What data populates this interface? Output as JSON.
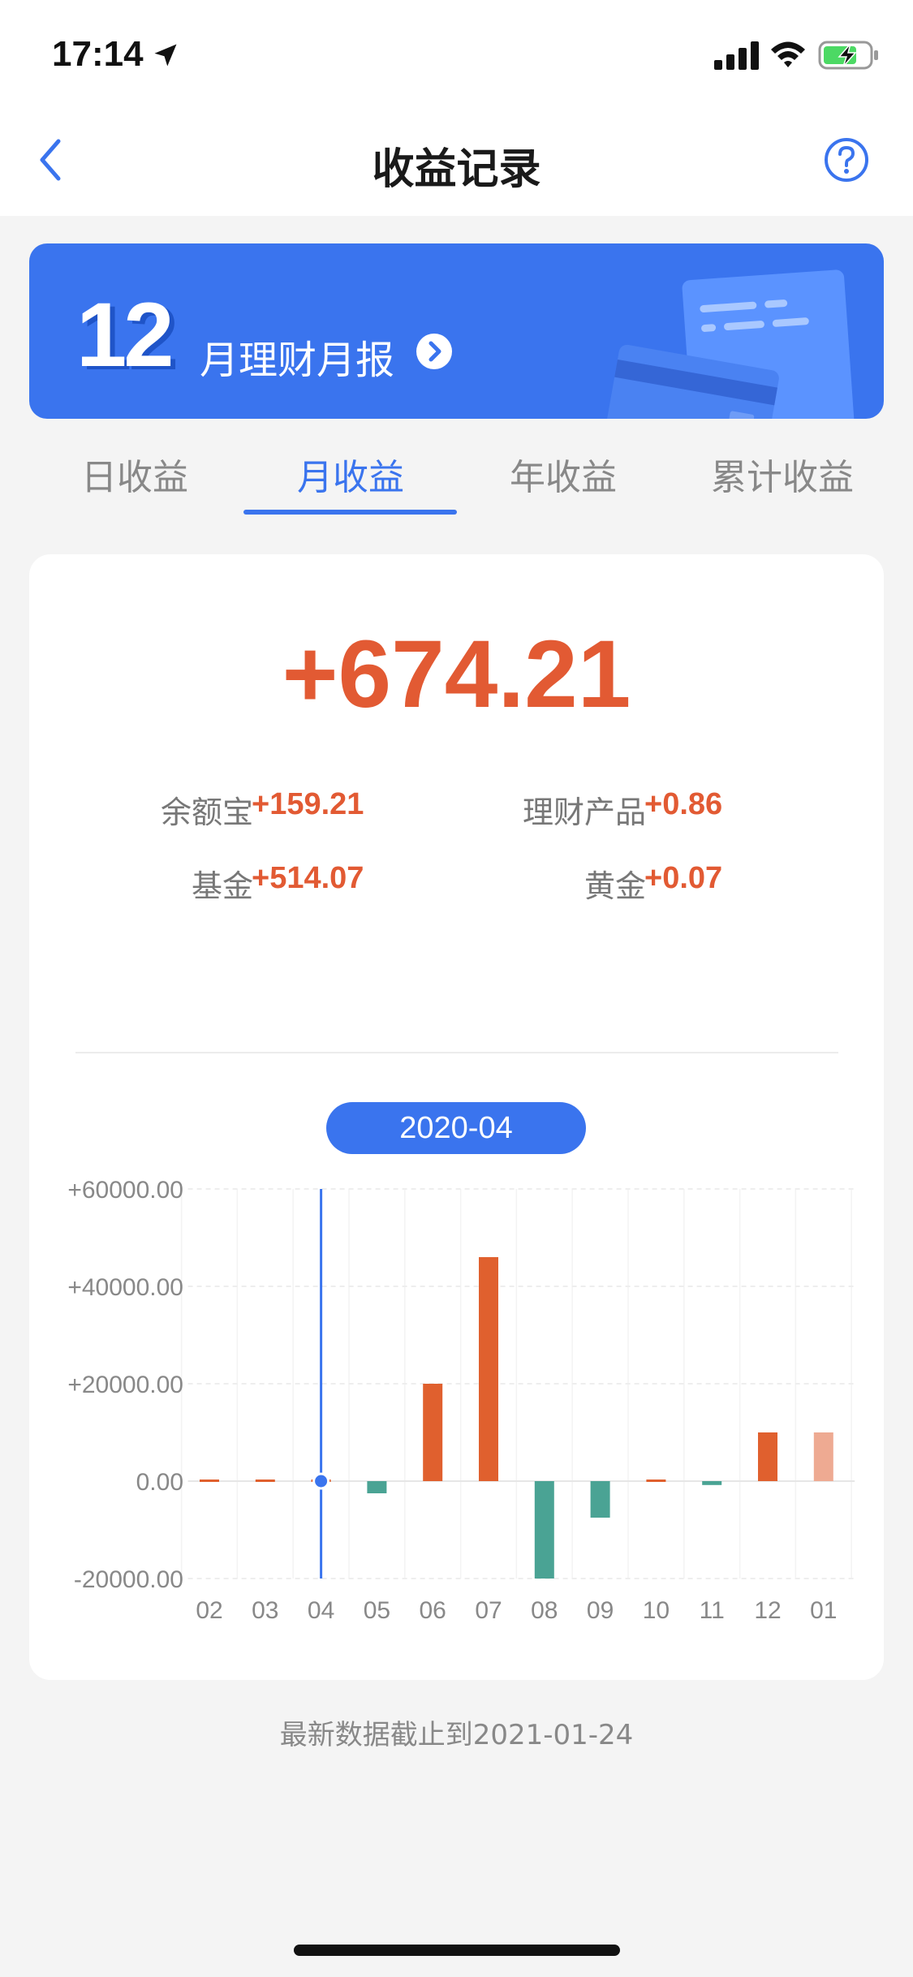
{
  "status_bar": {
    "time": "17:14"
  },
  "nav": {
    "title": "收益记录",
    "back_icon": "chevron-left-icon",
    "help_icon": "question-circle-icon"
  },
  "banner": {
    "month_number": "12",
    "text": "月理财月报"
  },
  "tabs": [
    {
      "label": "日收益",
      "active": false
    },
    {
      "label": "月收益",
      "active": true
    },
    {
      "label": "年收益",
      "active": false
    },
    {
      "label": "累计收益",
      "active": false
    }
  ],
  "summary": {
    "total": "+674.21",
    "breakdown": [
      {
        "label": "余额宝",
        "value": "+159.21"
      },
      {
        "label": "理财产品",
        "value": "+0.86"
      },
      {
        "label": "基金",
        "value": "+514.07"
      },
      {
        "label": "黄金",
        "value": "+0.07"
      }
    ]
  },
  "selected_month": "2020-04",
  "chart_data": {
    "type": "bar",
    "categories": [
      "02",
      "03",
      "04",
      "05",
      "06",
      "07",
      "08",
      "09",
      "10",
      "11",
      "12",
      "01"
    ],
    "values": [
      200,
      200,
      0,
      -2500,
      20000,
      46000,
      -20000,
      -7500,
      200,
      -800,
      10000,
      10000
    ],
    "y_tick_labels": [
      "+60000.00",
      "+40000.00",
      "+20000.00",
      "0.00",
      "-20000.00"
    ],
    "ylim": [
      -20000,
      60000
    ],
    "selected_index": 2,
    "colors": {
      "positive": "#e0602e",
      "negative": "#4aa394",
      "latest": "#eeaa92",
      "cursor": "#3a74ee"
    }
  },
  "footer_note": "最新数据截止到2021-01-24"
}
